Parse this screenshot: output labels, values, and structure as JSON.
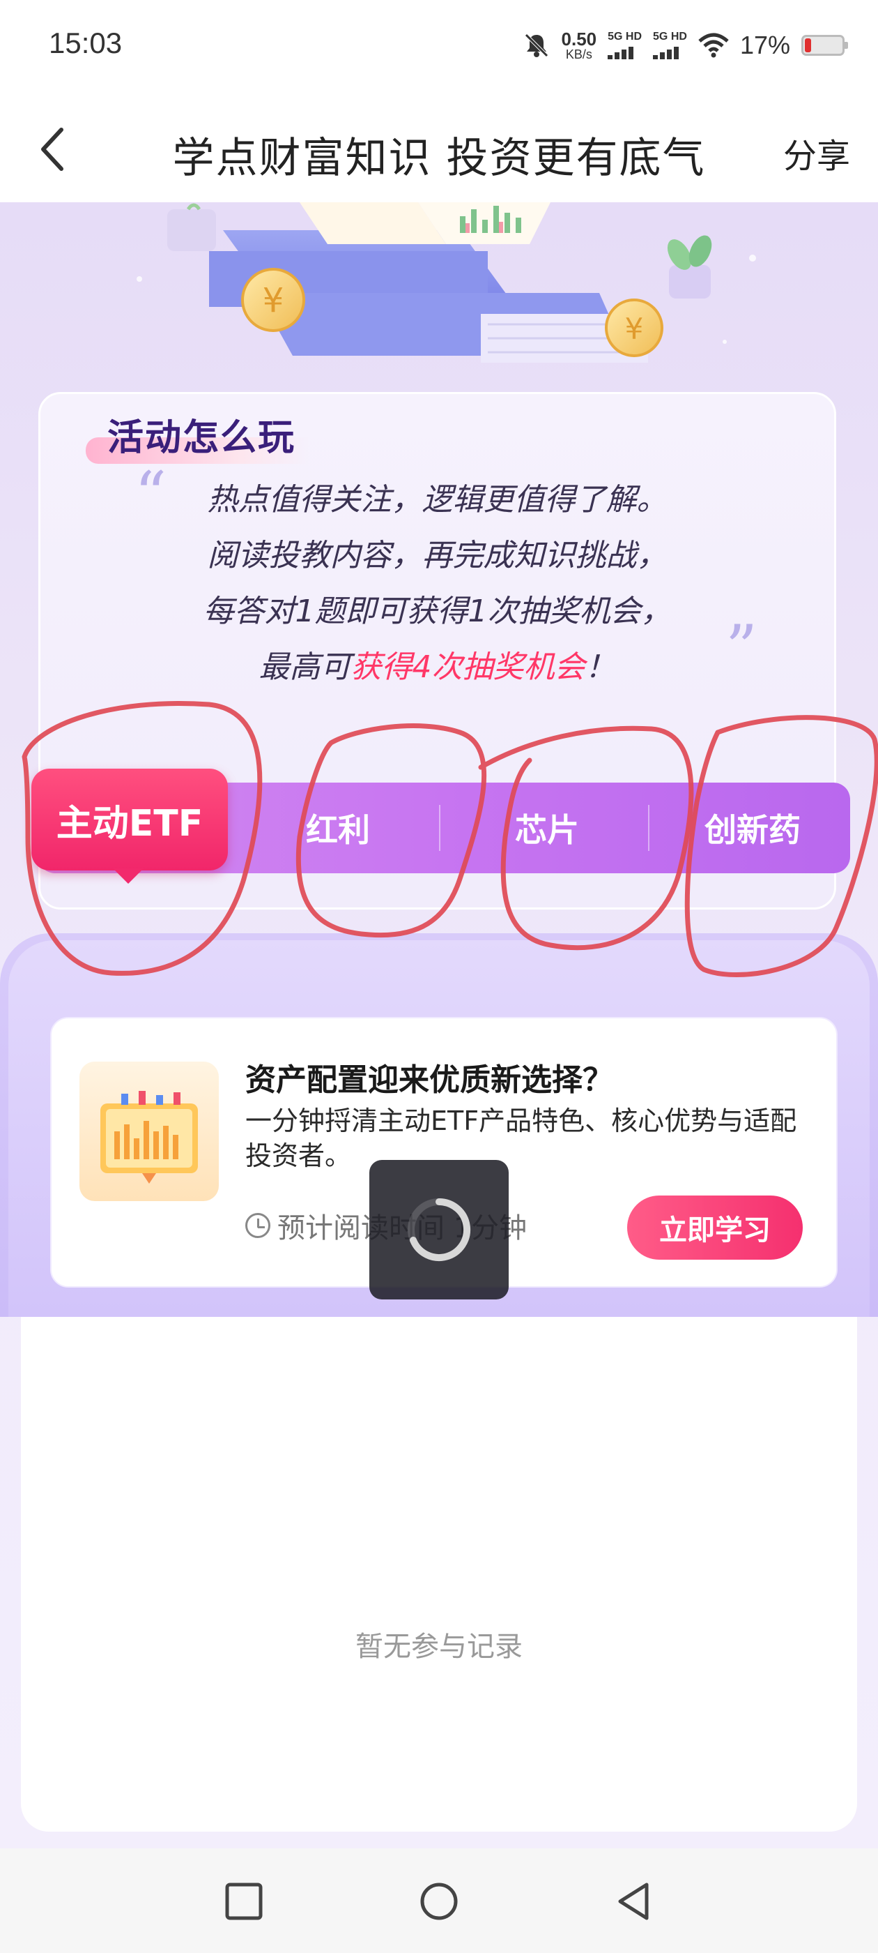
{
  "status_bar": {
    "time": "15:03",
    "net_speed_value": "0.50",
    "net_speed_unit": "KB/s",
    "signal_1": "5G HD",
    "signal_2": "5G HD",
    "battery_text": "17%",
    "battery_level": 0.17,
    "colors": {
      "battery_low": "#e03030"
    }
  },
  "nav": {
    "title": "学点财富知识 投资更有底气",
    "share_label": "分享"
  },
  "rules": {
    "title": "活动怎么玩",
    "line1": "热点值得关注，逻辑更值得了解。",
    "line2": "阅读投教内容，再完成知识挑战，",
    "line3": "每答对1题即可获得1次抽奖机会，",
    "line4_prefix": "最高可",
    "line4_highlight": "获得4次抽奖机会",
    "line4_suffix": "！"
  },
  "tabs": [
    {
      "label": "主动ETF",
      "active": true
    },
    {
      "label": "红利",
      "active": false
    },
    {
      "label": "芯片",
      "active": false
    },
    {
      "label": "创新药",
      "active": false
    }
  ],
  "edu_card": {
    "title": "资产配置迎来优质新选择？",
    "description": "一分钟捋清主动ETF产品特色、核心优势与适配投资者。",
    "read_time": "预计阅读时间 1分钟",
    "button_label": "立即学习"
  },
  "records": {
    "empty_text": "暂无参与记录"
  },
  "colors": {
    "accent_pink": "#f1266a",
    "tab_purple": "#c775f1",
    "highlight_text": "#ff3767",
    "annotation_red": "#e04a55"
  }
}
